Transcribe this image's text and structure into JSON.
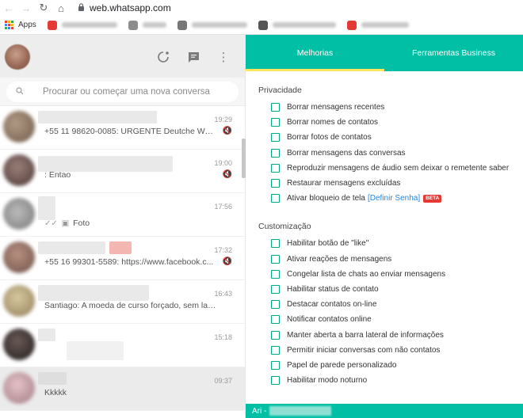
{
  "browser": {
    "url": "web.whatsapp.com",
    "apps_label": "Apps"
  },
  "left": {
    "search": {
      "placeholder": "Procurar ou começar uma nova conversa"
    },
    "chats": [
      {
        "time": "19:29",
        "preview": "+55 11 98620-0085: URGENTE Deutche Well...",
        "muted": true
      },
      {
        "time": "19:00",
        "preview": ": Entao",
        "muted": true
      },
      {
        "time": "17:56",
        "preview": "Foto",
        "muted": false
      },
      {
        "time": "17:32",
        "preview": "+55 16 99301-5589: https://www.facebook.c...",
        "muted": true
      },
      {
        "time": "16:43",
        "preview": "Santiago: A moeda de curso forçado, sem lastro...",
        "muted": false
      },
      {
        "time": "15:18",
        "preview": "",
        "muted": false
      },
      {
        "time": "09:37",
        "preview": "Kkkkk",
        "muted": false
      }
    ]
  },
  "right": {
    "tabs": {
      "active": "Melhorias",
      "other": "Ferramentas Business"
    },
    "privacy": {
      "title": "Privacidade",
      "options": [
        "Borrar mensagens recentes",
        "Borrar nomes de contatos",
        "Borrar fotos de contatos",
        "Borrar mensagens das conversas",
        "Reproduzir mensagens de áudio sem deixar o remetente saber",
        "Restaurar mensagens excluídas",
        "Ativar bloqueio de tela"
      ],
      "lock_link": "[Definir Senha]",
      "beta": "BETA"
    },
    "custom": {
      "title": "Customização",
      "options": [
        "Habilitar botão de \"like\"",
        "Ativar reações de mensagens",
        "Congelar lista de chats ao enviar mensagens",
        "Habilitar status de contato",
        "Destacar contatos on-line",
        "Notificar contatos online",
        "Manter aberta a barra lateral de informações",
        "Permitir iniciar conversas com não contatos",
        "Papel de parede personalizado",
        "Habilitar modo noturno"
      ]
    },
    "footer": {
      "label": "Ari -"
    }
  },
  "colors": {
    "accent": "#00bfa5",
    "tab_underline": "#ffe55c",
    "checkbox": "#00a884",
    "link": "#1e88e5",
    "beta": "#e53935"
  }
}
